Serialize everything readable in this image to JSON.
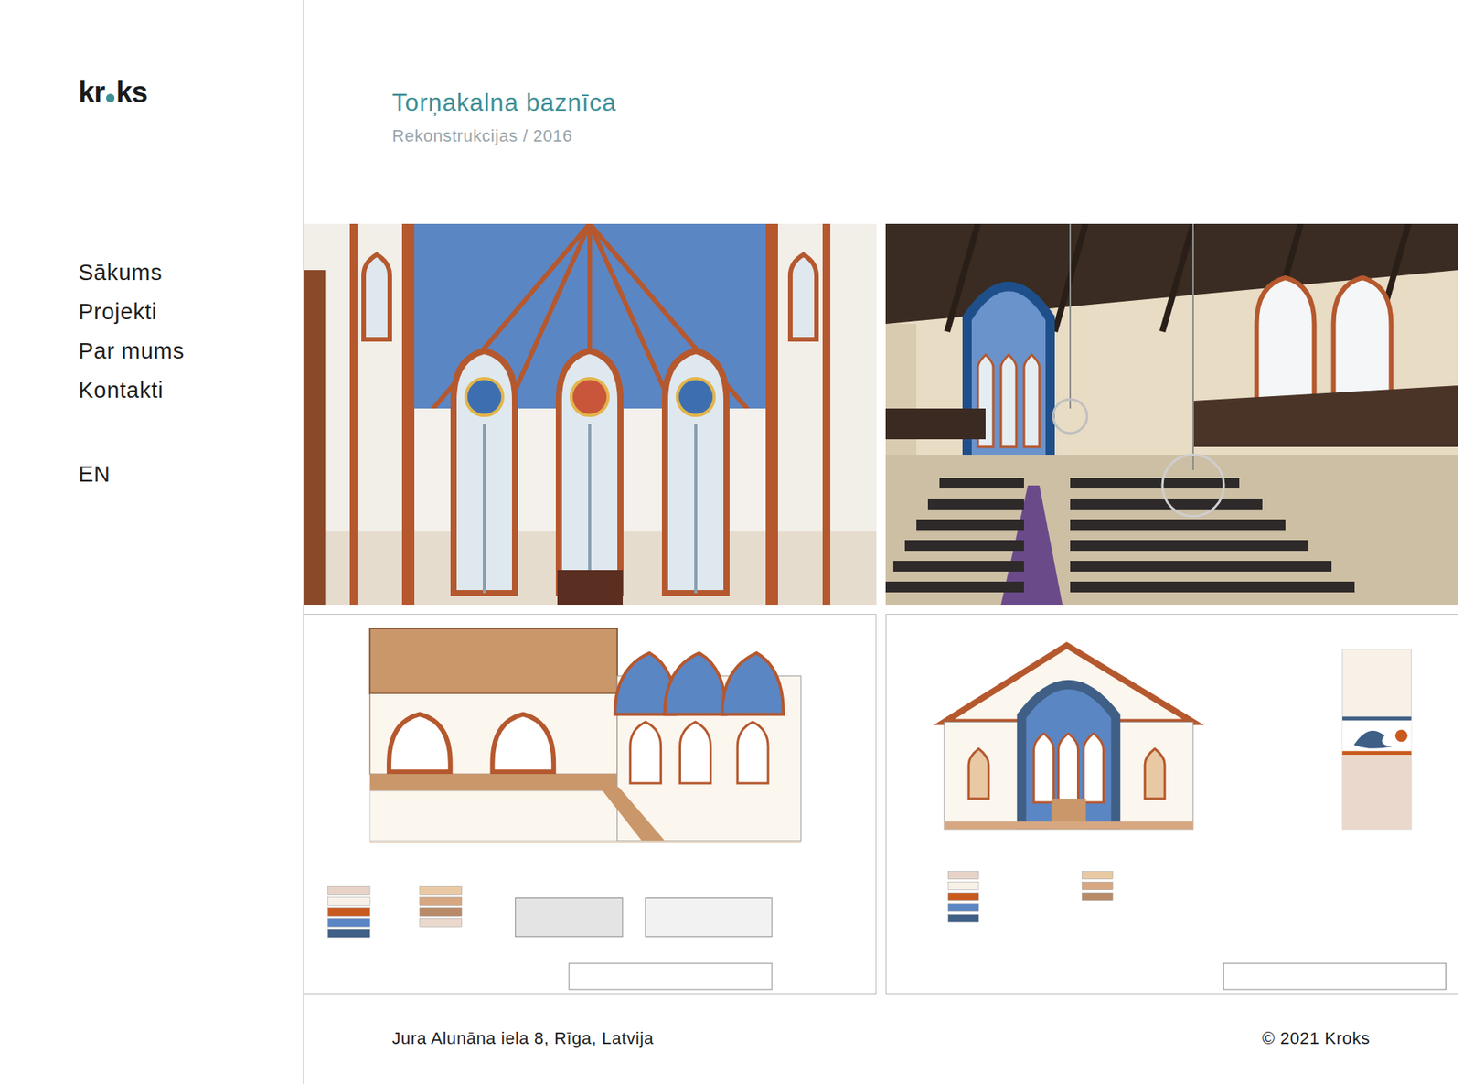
{
  "logo": {
    "before": "kr",
    "after": "ks"
  },
  "nav": {
    "items": [
      {
        "label": "Sākums",
        "selected": false
      },
      {
        "label": "Projekti",
        "selected": false
      },
      {
        "label": "Par mums",
        "selected": false
      },
      {
        "label": "Kontakti",
        "selected": false
      }
    ],
    "language": "EN"
  },
  "project": {
    "title": "Torņakalna baznīca",
    "subtitle": "Rekonstrukcijas / 2016"
  },
  "gallery": [
    {
      "kind": "apse"
    },
    {
      "kind": "nave"
    },
    {
      "kind": "elevation"
    },
    {
      "kind": "section"
    }
  ],
  "footer": {
    "address": "Jura Alunāna iela 8, Rīga, Latvija",
    "copyright": "© 2021 Kroks"
  }
}
